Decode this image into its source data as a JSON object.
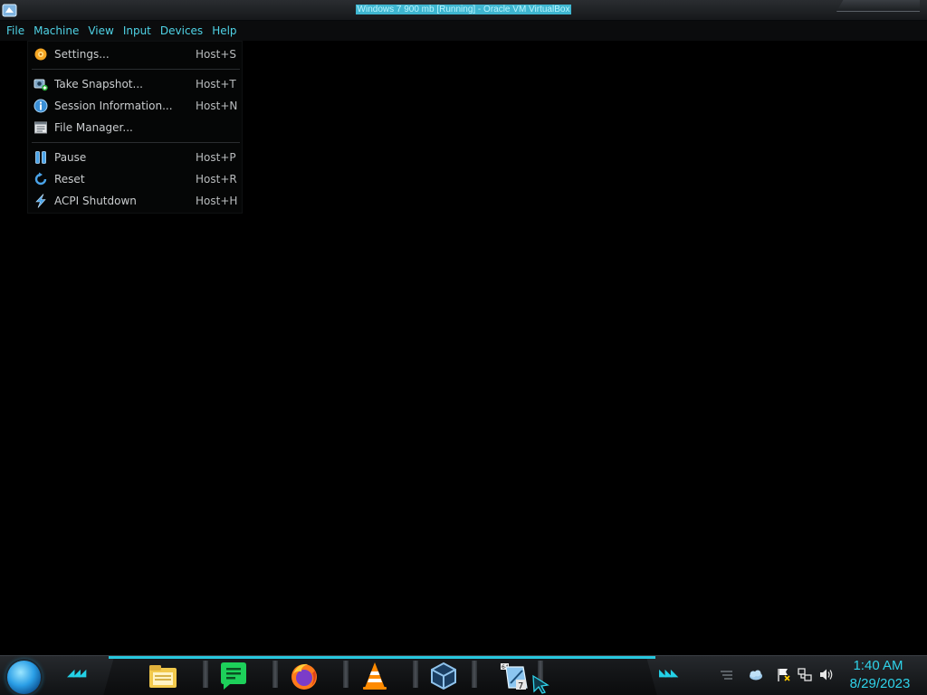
{
  "window": {
    "title": "Windows 7 900 mb [Running] - Oracle VM VirtualBox"
  },
  "menubar": {
    "items": [
      {
        "label": "File"
      },
      {
        "label": "Machine"
      },
      {
        "label": "View"
      },
      {
        "label": "Input"
      },
      {
        "label": "Devices"
      },
      {
        "label": "Help"
      }
    ]
  },
  "machine_menu": {
    "items": [
      {
        "label": "Settings...",
        "shortcut": "Host+S",
        "icon": "settings-gear-icon"
      },
      {
        "label": "Take Snapshot...",
        "shortcut": "Host+T",
        "icon": "snapshot-camera-icon"
      },
      {
        "label": "Session Information...",
        "shortcut": "Host+N",
        "icon": "info-icon"
      },
      {
        "label": "File Manager...",
        "shortcut": "",
        "icon": "file-manager-icon"
      },
      {
        "label": "Pause",
        "shortcut": "Host+P",
        "icon": "pause-icon"
      },
      {
        "label": "Reset",
        "shortcut": "Host+R",
        "icon": "reset-icon"
      },
      {
        "label": "ACPI Shutdown",
        "shortcut": "Host+H",
        "icon": "acpi-shutdown-icon"
      }
    ]
  },
  "taskbar": {
    "apps": [
      {
        "icon": "file-explorer-icon"
      },
      {
        "icon": "notes-app-icon"
      },
      {
        "icon": "firefox-icon"
      },
      {
        "icon": "vlc-icon"
      },
      {
        "icon": "virtualbox-icon"
      },
      {
        "icon": "windows7-vm-icon"
      }
    ],
    "tray": {
      "time": "1:40 AM",
      "date": "8/29/2023"
    }
  },
  "colors": {
    "accent": "#2fd3ea",
    "menu_text": "#4fd3e6",
    "background": "#000000"
  }
}
